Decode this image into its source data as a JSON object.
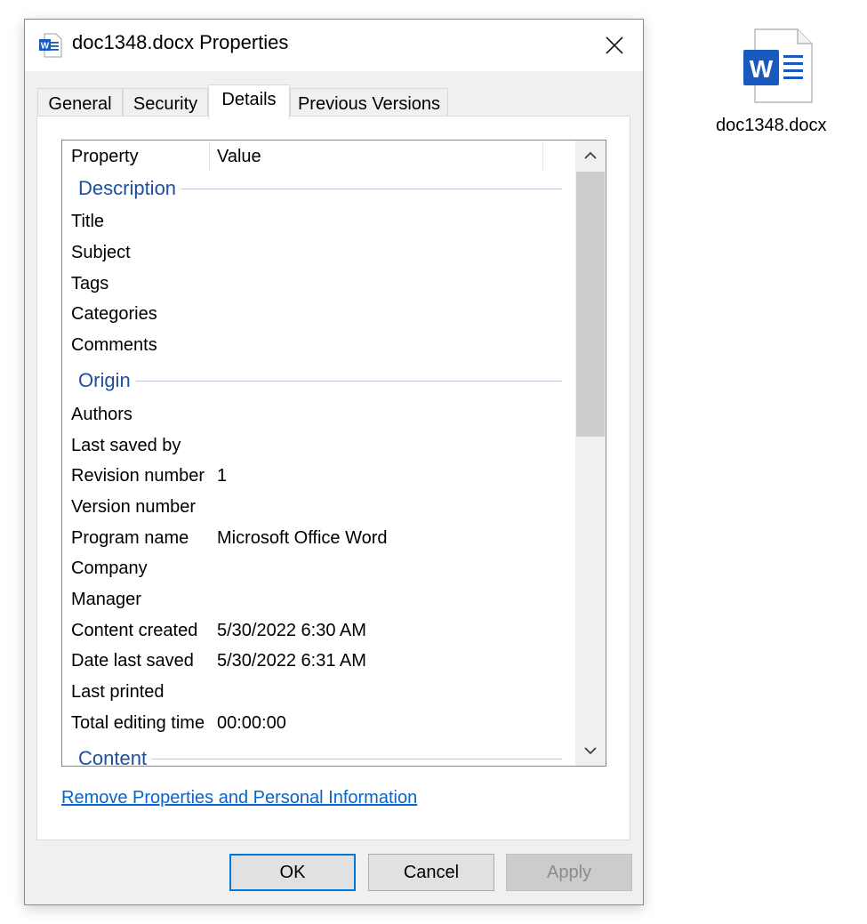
{
  "window": {
    "title": "doc1348.docx Properties",
    "icon": "word-doc-icon"
  },
  "tabs": [
    {
      "label": "General",
      "active": false
    },
    {
      "label": "Security",
      "active": false
    },
    {
      "label": "Details",
      "active": true
    },
    {
      "label": "Previous Versions",
      "active": false
    }
  ],
  "details": {
    "columns": {
      "property": "Property",
      "value": "Value"
    },
    "groups": {
      "description": {
        "label": "Description",
        "rows": [
          {
            "name": "Title",
            "value": ""
          },
          {
            "name": "Subject",
            "value": ""
          },
          {
            "name": "Tags",
            "value": ""
          },
          {
            "name": "Categories",
            "value": ""
          },
          {
            "name": "Comments",
            "value": ""
          }
        ]
      },
      "origin": {
        "label": "Origin",
        "rows": [
          {
            "name": "Authors",
            "value": ""
          },
          {
            "name": "Last saved by",
            "value": ""
          },
          {
            "name": "Revision number",
            "value": "1"
          },
          {
            "name": "Version number",
            "value": ""
          },
          {
            "name": "Program name",
            "value": "Microsoft Office Word"
          },
          {
            "name": "Company",
            "value": ""
          },
          {
            "name": "Manager",
            "value": ""
          },
          {
            "name": "Content created",
            "value": "5/30/2022 6:30 AM"
          },
          {
            "name": "Date last saved",
            "value": "5/30/2022 6:31 AM"
          },
          {
            "name": "Last printed",
            "value": ""
          },
          {
            "name": "Total editing time",
            "value": "00:00:00"
          }
        ]
      },
      "content": {
        "label": "Content"
      }
    }
  },
  "remove_link": "Remove Properties and Personal Information",
  "buttons": {
    "ok": "OK",
    "cancel": "Cancel",
    "apply": "Apply"
  },
  "desktop": {
    "file_label": "doc1348.docx",
    "icon": "word-doc-icon"
  },
  "colors": {
    "word_blue": "#185abd",
    "group_header": "#1e4e9c",
    "link": "#0a64c8",
    "focus": "#0078d7"
  }
}
